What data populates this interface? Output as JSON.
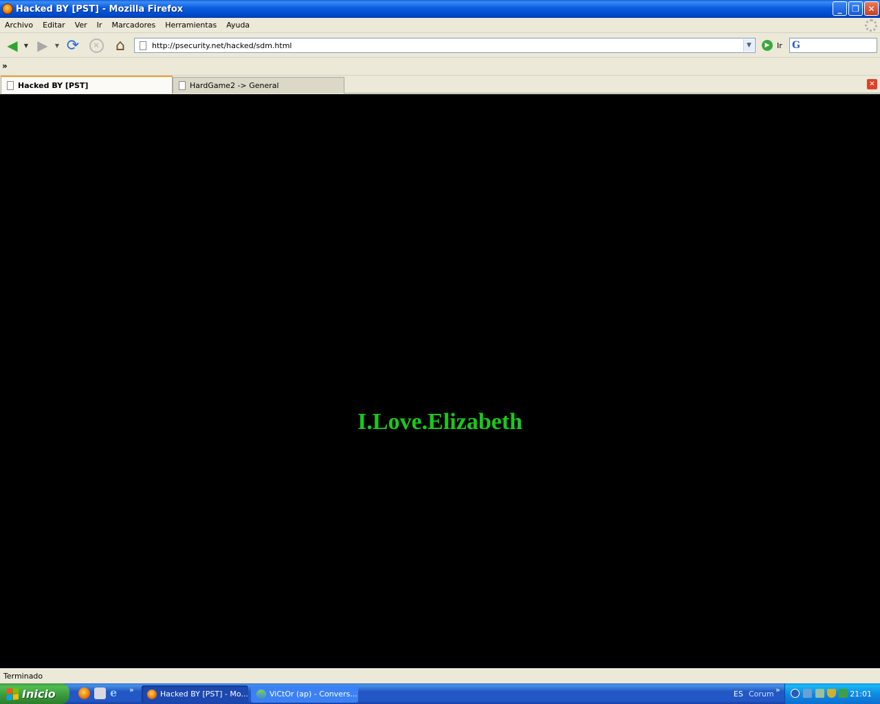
{
  "window": {
    "title": "Hacked BY [PST] - Mozilla Firefox",
    "buttons": {
      "minimize": "_",
      "maximize": "❐",
      "close": "✕"
    }
  },
  "menu": {
    "items": [
      "Archivo",
      "Editar",
      "Ver",
      "Ir",
      "Marcadores",
      "Herramientas",
      "Ayuda"
    ]
  },
  "toolbar": {
    "url": "http://psecurity.net/hacked/sdm.html",
    "go_label": "Ir",
    "search_engine": "G",
    "search_value": ""
  },
  "bookmarks": {
    "chevron": "»"
  },
  "tabs": [
    {
      "label": "Hacked BY [PST]",
      "active": true
    },
    {
      "label": "HardGame2 -> General",
      "active": false
    }
  ],
  "page": {
    "text": "I.Love.Elizabeth",
    "background": "#000000",
    "text_color": "#1ac81a"
  },
  "status": {
    "text": "Terminado"
  },
  "taskbar": {
    "start_label": "Inicio",
    "tasks": [
      {
        "label": "Hacked BY [PST] - Mo..."
      },
      {
        "label": "ViCtOr (ap) - Convers..."
      }
    ],
    "language": "ES",
    "toolbar_label": "Corum",
    "clock": "21:01"
  },
  "icons": {
    "back": "back-arrow-icon",
    "forward": "forward-arrow-icon",
    "reload": "reload-icon",
    "stop": "stop-icon",
    "home": "home-icon",
    "go": "go-icon"
  }
}
